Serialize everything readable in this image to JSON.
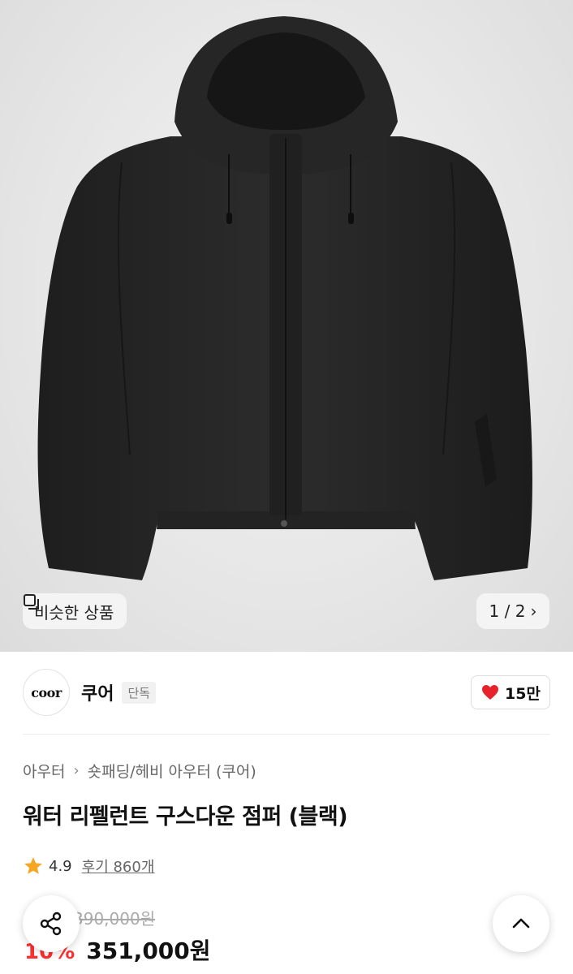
{
  "gallery": {
    "similar_label": "비슷한 상품",
    "current": "1",
    "total": "2",
    "counter_text": "1 / 2"
  },
  "brand": {
    "logo_text": "coor",
    "name": "쿠어",
    "badge": "단독"
  },
  "like": {
    "count": "15만",
    "color": "#e8222a"
  },
  "breadcrumb": {
    "category": "아우터",
    "subcategory": "숏패딩/헤비 아우터 (쿠어)"
  },
  "product": {
    "title": "워터 리펠런트 구스다운 점퍼 (블랙)",
    "rating": "4.9",
    "review_label": "후기 860개",
    "original_price": "390,000원",
    "discount": "10%",
    "price": "351,000원"
  },
  "colors": {
    "accent_red": "#ff2f2f",
    "star": "#f5a623"
  },
  "icons": [
    "similar-items-icon",
    "chevron-right-icon",
    "heart-icon",
    "star-icon",
    "share-icon",
    "chevron-up-icon"
  ]
}
